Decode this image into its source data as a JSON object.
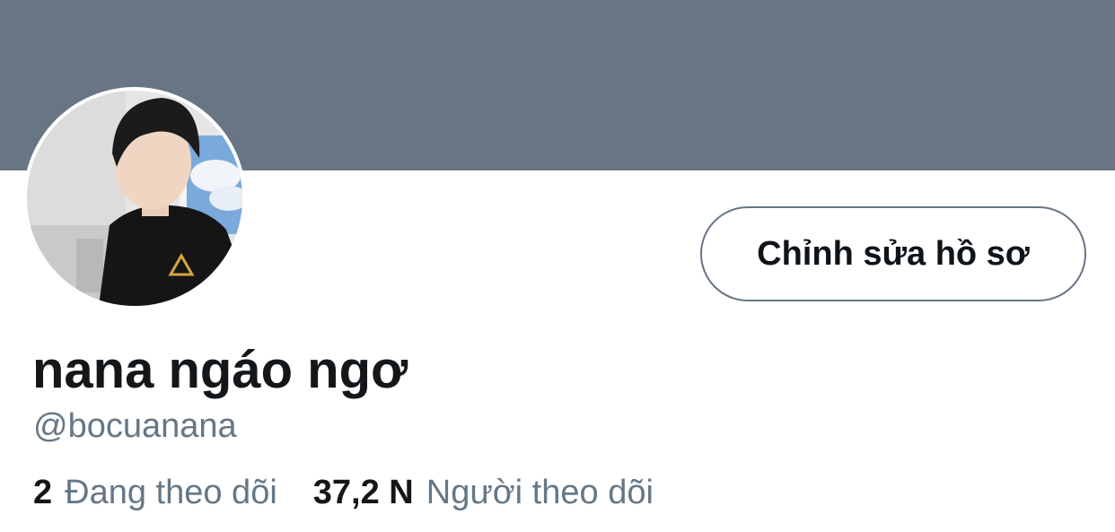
{
  "profile": {
    "display_name": "nana ngáo ngơ",
    "handle": "@bocuanana",
    "edit_button_label": "Chỉnh sửa hồ sơ"
  },
  "stats": {
    "following_count": "2",
    "following_label": "Đang theo dõi",
    "followers_count": "37,2 N",
    "followers_label": "Người theo dõi"
  },
  "colors": {
    "banner": "#677584",
    "secondary_text": "#657786",
    "primary_text": "#14171a"
  }
}
